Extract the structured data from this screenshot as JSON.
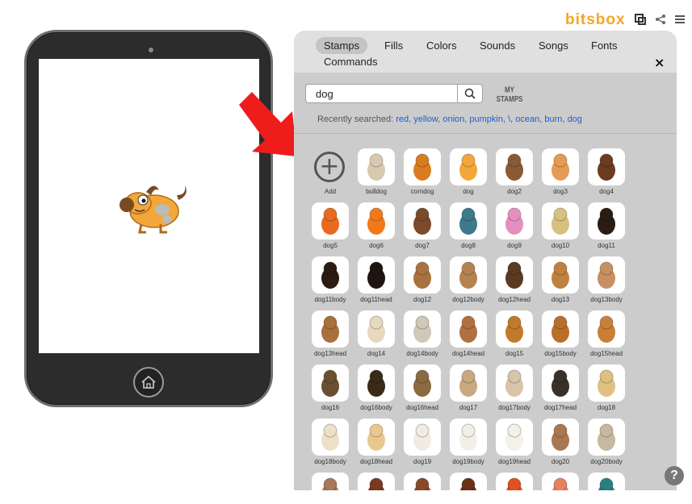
{
  "brand": {
    "logo": "bitsbox",
    "icons": [
      "stamp-icon",
      "share-icon",
      "menu-icon"
    ]
  },
  "tablet": {
    "sprite": "dog"
  },
  "tabs": [
    {
      "label": "Stamps",
      "active": true
    },
    {
      "label": "Fills",
      "active": false
    },
    {
      "label": "Colors",
      "active": false
    },
    {
      "label": "Sounds",
      "active": false
    },
    {
      "label": "Songs",
      "active": false
    },
    {
      "label": "Fonts",
      "active": false
    },
    {
      "label": "Commands",
      "active": false
    }
  ],
  "close_label": "×",
  "search": {
    "value": "dog",
    "my_stamps_label": "MY STAMPS"
  },
  "recent": {
    "label": "Recently searched:",
    "items": [
      "red",
      "yellow",
      "onion",
      "pumpkin",
      "\\",
      "ocean",
      "burn",
      "dog"
    ]
  },
  "stamps": [
    {
      "label": "Add",
      "color": "#ffffff"
    },
    {
      "label": "bulldog",
      "color": "#d8c8b0"
    },
    {
      "label": "corndog",
      "color": "#d97c20"
    },
    {
      "label": "dog",
      "color": "#f3a73a"
    },
    {
      "label": "dog2",
      "color": "#8a5a35"
    },
    {
      "label": "dog3",
      "color": "#e59a55"
    },
    {
      "label": "dog4",
      "color": "#6b3b22"
    },
    {
      "label": "dog5",
      "color": "#e86a1e"
    },
    {
      "label": "dog6",
      "color": "#f07a1a"
    },
    {
      "label": "dog7",
      "color": "#7a4a2a"
    },
    {
      "label": "dog8",
      "color": "#3c7a8c"
    },
    {
      "label": "dog9",
      "color": "#e58fc0"
    },
    {
      "label": "dog10",
      "color": "#d8c080"
    },
    {
      "label": "dog11",
      "color": "#2a1c12"
    },
    {
      "label": "dog11body",
      "color": "#2a1c12"
    },
    {
      "label": "dog11head",
      "color": "#1e1410"
    },
    {
      "label": "dog12",
      "color": "#a8733f"
    },
    {
      "label": "dog12body",
      "color": "#b58350"
    },
    {
      "label": "dog12head",
      "color": "#5a3a20"
    },
    {
      "label": "dog13",
      "color": "#c08040"
    },
    {
      "label": "dog13body",
      "color": "#c89060"
    },
    {
      "label": "dog13head",
      "color": "#a8703a"
    },
    {
      "label": "dog14",
      "color": "#e8d8c0"
    },
    {
      "label": "dog14body",
      "color": "#d0c8b8"
    },
    {
      "label": "dog14head",
      "color": "#b07040"
    },
    {
      "label": "dog15",
      "color": "#c07a2a"
    },
    {
      "label": "dog15body",
      "color": "#b87028"
    },
    {
      "label": "dog15head",
      "color": "#c88038"
    },
    {
      "label": "dog16",
      "color": "#6a5030"
    },
    {
      "label": "dog16body",
      "color": "#3a2a1a"
    },
    {
      "label": "dog16head",
      "color": "#8a6a40"
    },
    {
      "label": "dog17",
      "color": "#c8a880"
    },
    {
      "label": "dog17body",
      "color": "#d8c4a8"
    },
    {
      "label": "dog17head",
      "color": "#3a3028"
    },
    {
      "label": "dog18",
      "color": "#e0c080"
    },
    {
      "label": "dog18body",
      "color": "#ece0c8"
    },
    {
      "label": "dog18head",
      "color": "#e8c890"
    },
    {
      "label": "dog19",
      "color": "#f0ece4"
    },
    {
      "label": "dog19body",
      "color": "#f2eee8"
    },
    {
      "label": "dog19head",
      "color": "#f4f0ea"
    },
    {
      "label": "dog20",
      "color": "#a87850"
    },
    {
      "label": "dog20body",
      "color": "#c8b8a0"
    },
    {
      "label": "",
      "color": "#a87858"
    },
    {
      "label": "",
      "color": "#7a3a20"
    },
    {
      "label": "",
      "color": "#8a4a28"
    },
    {
      "label": "",
      "color": "#6a3018"
    },
    {
      "label": "",
      "color": "#e05020"
    },
    {
      "label": "",
      "color": "#e88060"
    },
    {
      "label": "",
      "color": "#2a8080"
    }
  ],
  "help_label": "?"
}
